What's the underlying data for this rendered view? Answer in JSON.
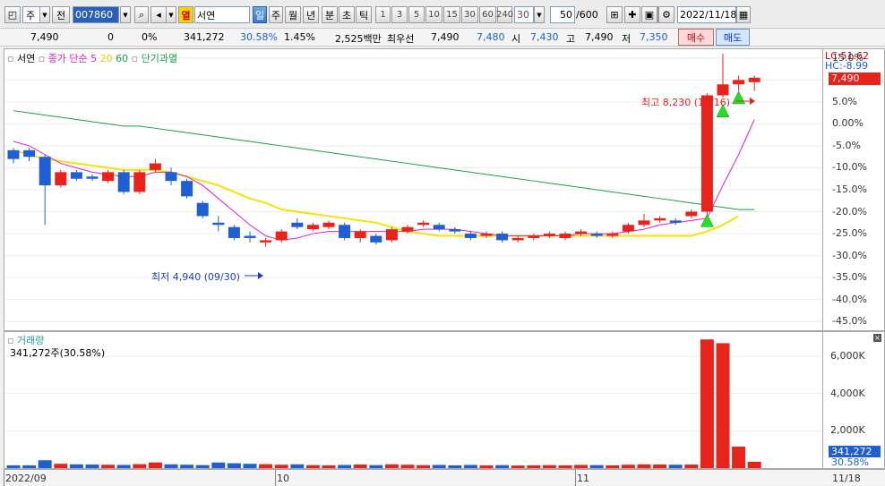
{
  "toolbar": {
    "market_type": "주",
    "all_label": "전",
    "code": "007860",
    "name": "서연",
    "period_buttons": [
      "일",
      "주",
      "월",
      "년",
      "분",
      "초",
      "틱"
    ],
    "active_period": "일",
    "intervals": [
      "1",
      "3",
      "5",
      "10",
      "15",
      "30",
      "60",
      "240"
    ],
    "interval_value": "30",
    "count": "50",
    "count_max": "/600",
    "date": "2022/11/18",
    "red_tag": "열"
  },
  "quote": {
    "price": "7,490",
    "change": "0",
    "change_pct": "0%",
    "volume": "341,272",
    "volume_ratio": "30.58%",
    "turnover_pct": "1.45%",
    "amount": "2,525백만",
    "best_bid_label": "최우선",
    "best_bid": "7,490",
    "best_ask": "7,480",
    "open_label": "시",
    "open": "7,430",
    "high_label": "고",
    "high": "7,490",
    "low_label": "저",
    "low": "7,350",
    "buy_label": "매수",
    "sell_label": "매도"
  },
  "legend": {
    "name": "서연",
    "ma_label": "종가 단순",
    "ma5": "5",
    "ma20": "20",
    "ma60": "60",
    "extra": "단기과열"
  },
  "annotations": {
    "high_text": "최고 8,230 (11/16)",
    "low_text": "최저 4,940 (09/30)"
  },
  "price_axis": {
    "lc": "LC:51.62",
    "hc": "HC:-8.99",
    "ticks": [
      "15.0%",
      "10.0%",
      "5.0%",
      "0.00%",
      "-5.0%",
      "-10.0%",
      "-15.0%",
      "-20.0%",
      "-25.0%",
      "-30.0%",
      "-35.0%",
      "-40.0%",
      "-45.0%"
    ],
    "current_tag": "7,490"
  },
  "volume_pane": {
    "title": "거래량",
    "summary": "341,272주(30.58%)",
    "ticks": [
      "6,000K",
      "4,000K",
      "2,000K"
    ],
    "current_tag": "341,272",
    "current_pct": "30.58%"
  },
  "date_axis": {
    "labels": [
      "2022/09",
      "10",
      "11"
    ],
    "right_label": "11/18"
  },
  "colors": {
    "up": "#e8231b",
    "down": "#1f5fd1",
    "ma5": "#e020c8",
    "ma20": "#f5e400",
    "ma60": "#19a04a"
  },
  "chart_data": {
    "type": "candlestick",
    "candles": [
      {
        "o": -6,
        "c": -8,
        "h": -5.5,
        "l": -9
      },
      {
        "o": -6,
        "c": -7.5,
        "h": -5.5,
        "l": -8.5
      },
      {
        "o": -7.5,
        "c": -14,
        "h": -7,
        "l": -23
      },
      {
        "o": -14,
        "c": -11,
        "h": -10.5,
        "l": -14.5
      },
      {
        "o": -11,
        "c": -12.5,
        "h": -10.5,
        "l": -13
      },
      {
        "o": -12,
        "c": -12.5,
        "h": -11.5,
        "l": -13
      },
      {
        "o": -13,
        "c": -11,
        "h": -10.5,
        "l": -13.5
      },
      {
        "o": -11,
        "c": -15.5,
        "h": -10.5,
        "l": -16
      },
      {
        "o": -15.5,
        "c": -11,
        "h": -10.5,
        "l": -16
      },
      {
        "o": -10.5,
        "c": -9,
        "h": -8,
        "l": -11
      },
      {
        "o": -11,
        "c": -13,
        "h": -10,
        "l": -14
      },
      {
        "o": -13,
        "c": -16.5,
        "h": -12.5,
        "l": -17
      },
      {
        "o": -18,
        "c": -21,
        "h": -17.5,
        "l": -21.5
      },
      {
        "o": -22.5,
        "c": -23,
        "h": -21,
        "l": -24.5
      },
      {
        "o": -23.5,
        "c": -26,
        "h": -23,
        "l": -26.5
      },
      {
        "o": -25.5,
        "c": -26,
        "h": -24.5,
        "l": -27
      },
      {
        "o": -27,
        "c": -26.5,
        "h": -26,
        "l": -28
      },
      {
        "o": -26.5,
        "c": -24.5,
        "h": -24,
        "l": -27
      },
      {
        "o": -22.5,
        "c": -23.5,
        "h": -21.5,
        "l": -24
      },
      {
        "o": -24,
        "c": -23,
        "h": -22.5,
        "l": -24.5
      },
      {
        "o": -23.5,
        "c": -22.5,
        "h": -22,
        "l": -24
      },
      {
        "o": -23,
        "c": -26,
        "h": -22.5,
        "l": -26.5
      },
      {
        "o": -26,
        "c": -24.5,
        "h": -24,
        "l": -27
      },
      {
        "o": -25.5,
        "c": -27,
        "h": -25,
        "l": -27.5
      },
      {
        "o": -26.5,
        "c": -24,
        "h": -23.5,
        "l": -27
      },
      {
        "o": -24.5,
        "c": -23.5,
        "h": -23,
        "l": -25
      },
      {
        "o": -23,
        "c": -22.5,
        "h": -22,
        "l": -23.5
      },
      {
        "o": -23,
        "c": -24,
        "h": -22.5,
        "l": -24.5
      },
      {
        "o": -24,
        "c": -24.5,
        "h": -23.5,
        "l": -25
      },
      {
        "o": -25,
        "c": -26,
        "h": -24.5,
        "l": -26.5
      },
      {
        "o": -25.5,
        "c": -25,
        "h": -24.5,
        "l": -26
      },
      {
        "o": -25,
        "c": -26.5,
        "h": -24.5,
        "l": -27
      },
      {
        "o": -26.5,
        "c": -26,
        "h": -25.5,
        "l": -27
      },
      {
        "o": -26,
        "c": -25.5,
        "h": -25,
        "l": -26.5
      },
      {
        "o": -25.5,
        "c": -25,
        "h": -24.5,
        "l": -26
      },
      {
        "o": -26,
        "c": -25,
        "h": -24.5,
        "l": -26.5
      },
      {
        "o": -25,
        "c": -24.5,
        "h": -24,
        "l": -25.5
      },
      {
        "o": -25,
        "c": -25.5,
        "h": -24.5,
        "l": -26
      },
      {
        "o": -25.5,
        "c": -25,
        "h": -24.5,
        "l": -26
      },
      {
        "o": -24.5,
        "c": -23,
        "h": -22.5,
        "l": -25
      },
      {
        "o": -23,
        "c": -22,
        "h": -20.5,
        "l": -23.5
      },
      {
        "o": -22,
        "c": -21.5,
        "h": -21,
        "l": -22.5
      },
      {
        "o": -22,
        "c": -22.5,
        "h": -21.5,
        "l": -23
      },
      {
        "o": -21,
        "c": -20,
        "h": -19.5,
        "l": -21.5
      },
      {
        "o": -20,
        "c": 6.5,
        "h": 7,
        "l": -21
      },
      {
        "o": 6.5,
        "c": 9,
        "h": 16,
        "l": 6
      },
      {
        "o": 9,
        "c": 10,
        "h": 11,
        "l": 7.5
      },
      {
        "o": 9.5,
        "c": 10.5,
        "h": 11,
        "l": 7.5
      }
    ],
    "ma5": [
      -4,
      -5,
      -7,
      -9,
      -10,
      -11,
      -11.5,
      -12,
      -12,
      -11,
      -11,
      -12,
      -14,
      -17,
      -20,
      -23,
      -25.5,
      -26.5,
      -26,
      -25,
      -24.5,
      -24.5,
      -24.5,
      -24.5,
      -24.5,
      -24.5,
      -24,
      -24,
      -24,
      -24.5,
      -25,
      -25.5,
      -25.5,
      -25.5,
      -25.5,
      -25.5,
      -25,
      -25,
      -25,
      -24.5,
      -24,
      -23,
      -22.5,
      -22,
      -21.5,
      -14,
      -7,
      1
    ],
    "ma20": [
      -6,
      -7,
      -8,
      -8.5,
      -9,
      -9.5,
      -10,
      -10.5,
      -10.5,
      -10.5,
      -11,
      -12,
      -13,
      -14,
      -15.5,
      -17,
      -18,
      -19.5,
      -20,
      -20.5,
      -21,
      -21.5,
      -22,
      -22.5,
      -23.5,
      -24.5,
      -25,
      -25.5,
      -25.5,
      -25.5,
      -25.5,
      -25.5,
      -25.5,
      -25.5,
      -25.5,
      -25.5,
      -25.5,
      -25.5,
      -25.5,
      -25.5,
      -25.5,
      -25.5,
      -25.5,
      -25.5,
      -24.5,
      -23,
      -21
    ],
    "ma60": [
      3,
      2.5,
      2,
      1.5,
      1,
      0.5,
      0,
      -0.5,
      -0.5,
      -1,
      -1.5,
      -2,
      -2.5,
      -3,
      -3.5,
      -4,
      -4.5,
      -5,
      -5.5,
      -6,
      -6.5,
      -7,
      -7.5,
      -8,
      -8.5,
      -9,
      -9.5,
      -10,
      -10.5,
      -11,
      -11.5,
      -12,
      -12.5,
      -13,
      -13.5,
      -14,
      -14.5,
      -15,
      -15.5,
      -16,
      -16.5,
      -17,
      -17.5,
      -18,
      -18.5,
      -19,
      -19.5,
      -19.5
    ],
    "triangles": [
      {
        "i": 44,
        "v": -22
      },
      {
        "i": 45,
        "v": 3
      },
      {
        "i": 46,
        "v": 6
      }
    ],
    "volumes": [
      150,
      150,
      420,
      230,
      200,
      190,
      180,
      170,
      210,
      300,
      200,
      180,
      160,
      300,
      260,
      230,
      210,
      180,
      200,
      160,
      150,
      170,
      190,
      160,
      200,
      180,
      160,
      170,
      150,
      170,
      150,
      160,
      140,
      150,
      160,
      150,
      170,
      160,
      150,
      180,
      200,
      190,
      180,
      190,
      6900,
      6700,
      1150,
      341
    ],
    "y_range": [
      -47,
      17
    ],
    "vol_range": [
      0,
      7200
    ]
  }
}
